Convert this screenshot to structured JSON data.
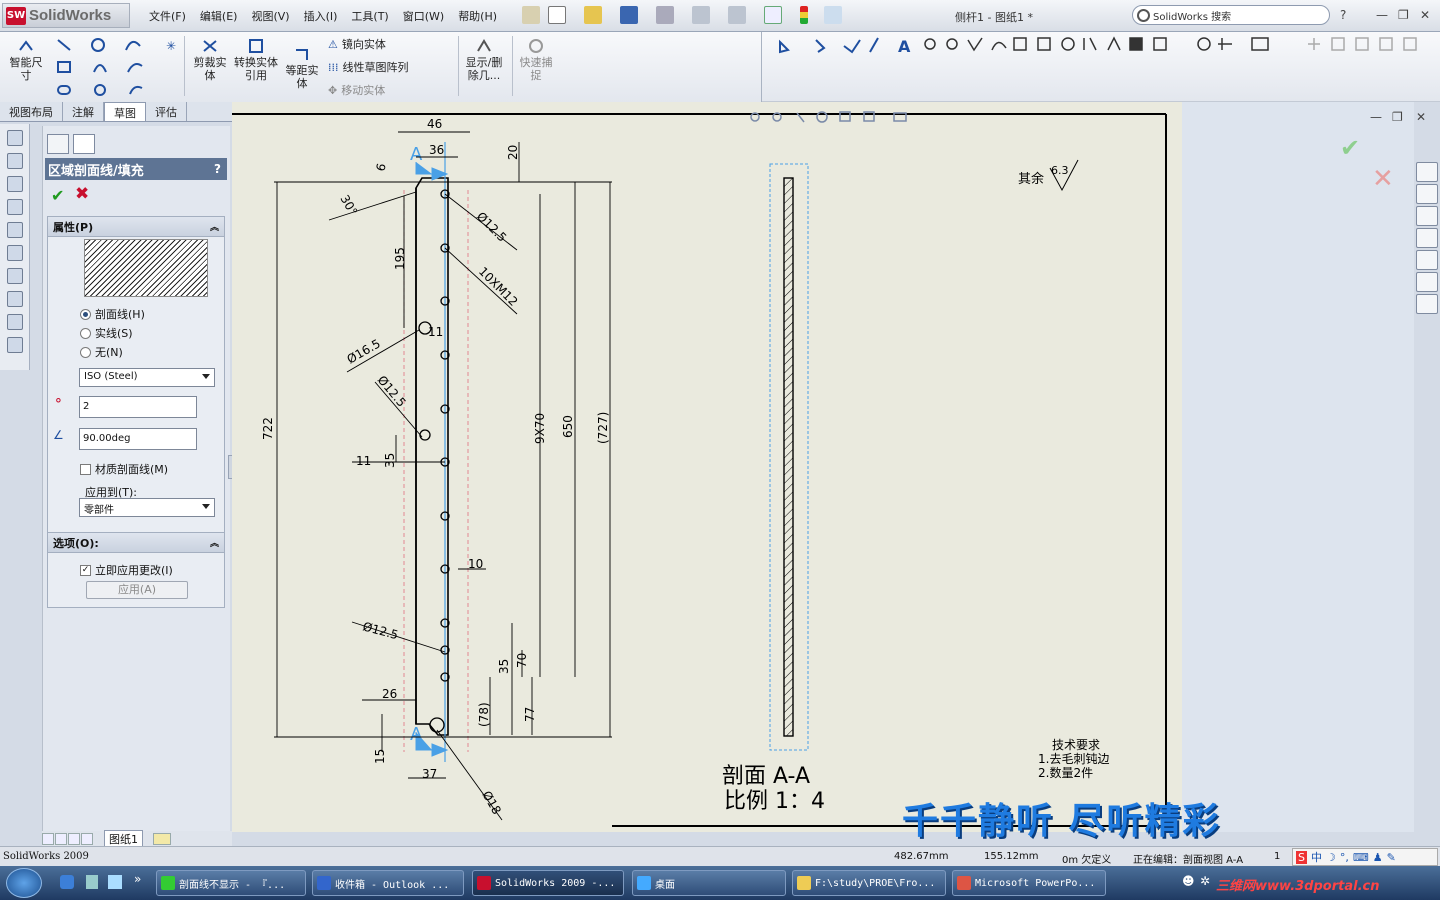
{
  "app": {
    "name": "SolidWorks",
    "badge": "SW",
    "document_title": "侧杆1 - 图纸1 *",
    "version_label": "SolidWorks 2009"
  },
  "menu": [
    "文件(F)",
    "编辑(E)",
    "视图(V)",
    "插入(I)",
    "工具(T)",
    "窗口(W)",
    "帮助(H)"
  ],
  "search": {
    "placeholder": "SolidWorks 搜索"
  },
  "command_manager": {
    "smart_dimension": "智能尺寸",
    "trim": "剪裁实体",
    "convert": "转换实体引用",
    "offset": "等距实体",
    "mirror": "镜向实体",
    "linear_pattern": "线性草图阵列",
    "move": "移动实体",
    "show_delete": "显示/删除几...",
    "quick_snap": "快速捕捉"
  },
  "tabs": [
    {
      "label": "视图布局"
    },
    {
      "label": "注解"
    },
    {
      "label": "草图"
    },
    {
      "label": "评估"
    }
  ],
  "property_manager": {
    "title": "区域剖面线/填充",
    "help": "?",
    "properties_group": "属性(P)",
    "radio_hatch": "剖面线(H)",
    "radio_solid": "实线(S)",
    "radio_none": "无(N)",
    "pattern": "ISO (Steel)",
    "scale": "2",
    "angle": "90.00deg",
    "material_hatch": "材质剖面线(M)",
    "apply_to_label": "应用到(T):",
    "apply_to_value": "零部件",
    "options_group": "选项(O):",
    "apply_immediately": "立即应用更改(I)",
    "apply_button": "应用(A)"
  },
  "sheet_tab": "图纸1",
  "drawing": {
    "dims": {
      "d46": "46",
      "d36": "36",
      "d20": "20",
      "d6": "6",
      "d30deg": "30°",
      "d12_5a": "Ø12.5",
      "d10xm12": "10XM12",
      "d195": "195",
      "d11": "11",
      "d16_5": "Ø16.5",
      "d12_5b": "Ø12.5",
      "d722": "722",
      "d9x70": "9X70",
      "d650": "650",
      "d727": "(727)",
      "d11b": "11",
      "d35a": "35",
      "d10": "10",
      "d12_5c": "Ø12.5",
      "d70": "70",
      "d35b": "35",
      "d26": "26",
      "d78": "(78)",
      "d77": "77",
      "d15": "15",
      "d37": "37",
      "d18": "Ø18"
    },
    "section_label": "A",
    "surface_finish_prefix": "其余",
    "surface_finish_value": "6.3",
    "view_title": "剖面 A-A",
    "view_scale": "比例 1：4",
    "tech_title": "技术要求",
    "tech_1": "1.去毛刺钝边",
    "tech_2": "2.数量2件"
  },
  "status_bar": {
    "x": "482.67mm",
    "y": "155.12mm",
    "z": "0m 欠定义",
    "editing": "正在编辑：剖面视图 A-A",
    "page": "1"
  },
  "watermark": "千千静听 尽听精彩",
  "taskbar": {
    "tasks": [
      "剖面线不显示 - 『...",
      "收件箱 - Outlook ...",
      "SolidWorks 2009 -...",
      "桌面",
      "F:\\study\\PROE\\Fro...",
      "Microsoft PowerPo..."
    ],
    "tray_text": "三维网www.3dportal.cn"
  },
  "colors": {
    "accent": "#5e7494",
    "canvas": "#eaeade",
    "dim_blue": "#4aa0e6",
    "brand_red": "#c8102e"
  }
}
